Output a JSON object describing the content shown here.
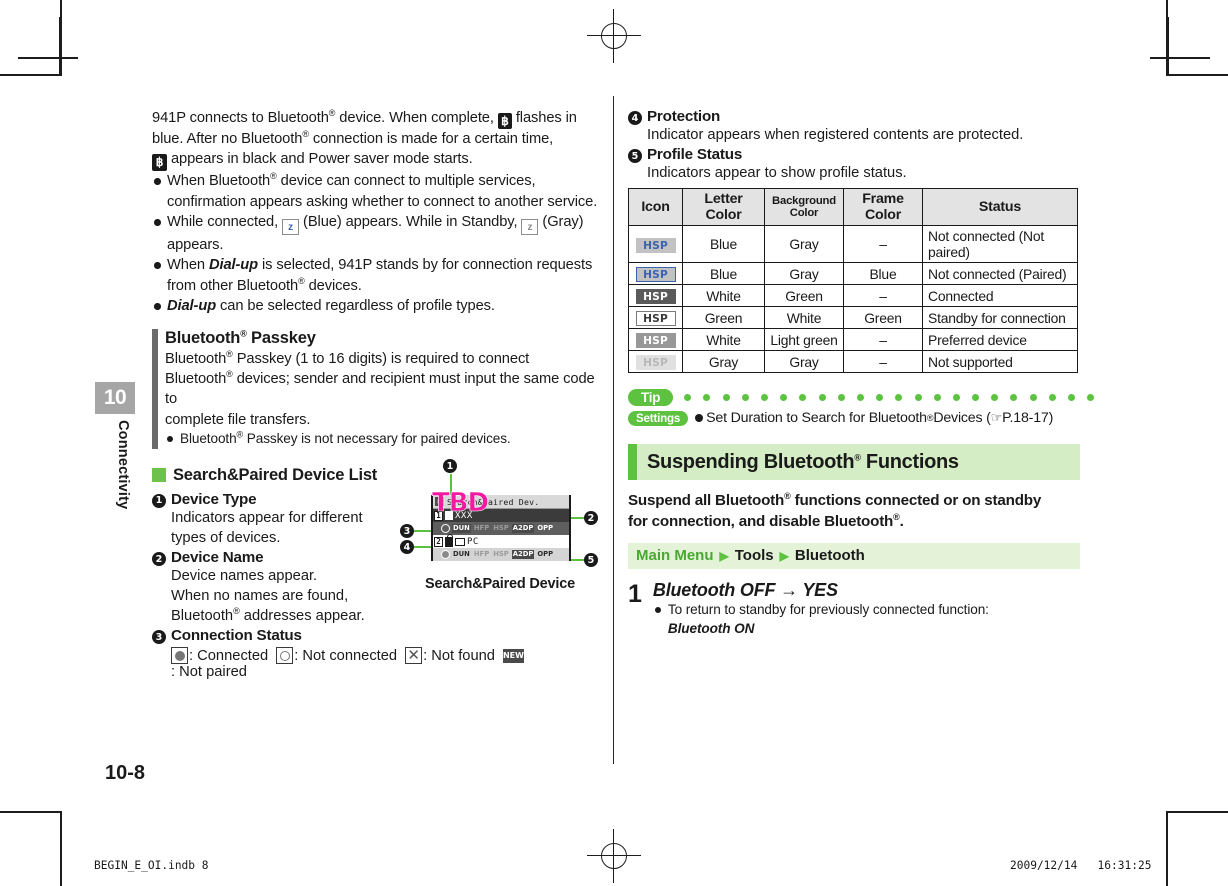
{
  "chapter": {
    "number": "10",
    "name": "Connectivity"
  },
  "page": {
    "number": "10-8"
  },
  "footer": {
    "file": "BEGIN_E_OI.indb     8",
    "stamp": "2009/12/14   16:31:25"
  },
  "left_column": {
    "intro": {
      "line1_a": "941P connects to Bluetooth",
      "line1_b": " device. When complete, ",
      "line1_c": " flashes in",
      "line2_a": "blue. After no Bluetooth",
      "line2_b": " connection is made for a certain time,",
      "line3": " appears in black and Power saver mode starts."
    },
    "intro_bullets": [
      "When Bluetooth® device can connect to multiple services, confirmation appears asking whether to connect to another service.",
      "While connected, (Blue) appears. While in Standby, (Gray) appears.",
      "When Dial-up is selected, 941P stands by for connection requests from other Bluetooth® devices.",
      "Dial-up can be selected regardless of profile types."
    ],
    "passkey": {
      "heading_a": "Bluetooth",
      "heading_b": " Passkey",
      "body_l1_a": "Bluetooth",
      "body_l1_b": " Passkey (1 to 16 digits) is required to connect",
      "body_l2_a": "Bluetooth",
      "body_l2_b": " devices; sender and recipient must input the same code to",
      "body_l3": "complete file transfers.",
      "bullet_a": "Bluetooth",
      "bullet_b": " Passkey is not necessary for paired devices."
    },
    "device_list": {
      "heading": "Search&Paired Device List",
      "items": [
        {
          "n": "1",
          "title": "Device Type",
          "lines": [
            "Indicators appear for different",
            "types of devices."
          ]
        },
        {
          "n": "2",
          "title": "Device Name",
          "lines": [
            "Device names appear.",
            "When no names are found,",
            "Bluetooth® addresses appear."
          ]
        },
        {
          "n": "3",
          "title": "Connection Status",
          "lines": []
        }
      ],
      "status_legend": [
        {
          "icon": "filled-circle-icon",
          "label": ": Connected"
        },
        {
          "icon": "hollow-circle-icon",
          "label": ": Not connected"
        },
        {
          "icon": "cross-icon",
          "label": ": Not found"
        },
        {
          "icon": "new-badge-icon",
          "label": ": Not paired"
        }
      ]
    },
    "mock": {
      "caption": "Search&Paired Device",
      "screen_title": "Search&Paired Dev.",
      "row1_index": "1",
      "row1_name": "XXX",
      "row2_index": "2",
      "row2_name": "PC",
      "row1_profiles": [
        "DUN",
        "HFP",
        "HSP",
        "A2DP",
        "OPP"
      ],
      "row2_profiles": [
        "DUN",
        "HFP",
        "HSP",
        "A2DP",
        "OPP"
      ],
      "overlay": "TBD",
      "callouts": [
        "1",
        "2",
        "3",
        "4",
        "5"
      ]
    }
  },
  "right_column": {
    "items": [
      {
        "n": "4",
        "title": "Protection",
        "body": "Indicator appears when registered contents are protected."
      },
      {
        "n": "5",
        "title": "Profile Status",
        "body": "Indicators appear to show profile status."
      }
    ],
    "profile_table": {
      "headers": [
        "Icon",
        "Letter Color",
        "Background Color",
        "Frame Color",
        "Status"
      ],
      "icon_label": "HSP",
      "rows": [
        {
          "letter": "Blue",
          "background": "Gray",
          "frame": "–",
          "status": "Not connected (Not paired)",
          "swatch": {
            "fg": "#3b63b2",
            "bg": "#c2c2c2",
            "border": "none"
          }
        },
        {
          "letter": "Blue",
          "background": "Gray",
          "frame": "Blue",
          "status": "Not connected (Paired)",
          "swatch": {
            "fg": "#3b63b2",
            "bg": "#c2c2c2",
            "border": "#3b63b2"
          }
        },
        {
          "letter": "White",
          "background": "Green",
          "frame": "–",
          "status": "Connected",
          "swatch": {
            "fg": "#ffffff",
            "bg": "#5a5a5a",
            "border": "none"
          }
        },
        {
          "letter": "Green",
          "background": "White",
          "frame": "Green",
          "status": "Standby for connection",
          "swatch": {
            "fg": "#3a3a3a",
            "bg": "#ffffff",
            "border": "#7a7a7a"
          }
        },
        {
          "letter": "White",
          "background": "Light green",
          "frame": "–",
          "status": "Preferred device",
          "swatch": {
            "fg": "#ffffff",
            "bg": "#989898",
            "border": "none"
          }
        },
        {
          "letter": "Gray",
          "background": "Gray",
          "frame": "–",
          "status": "Not supported",
          "swatch": {
            "fg": "#b8b8b8",
            "bg": "#e0e0e0",
            "border": "none"
          }
        }
      ]
    },
    "tip": {
      "label": "Tip",
      "settings_label": "Settings",
      "text_a": "Set Duration to Search for Bluetooth",
      "text_b": " Devices (",
      "ref": "P.18-17",
      "text_c": ")"
    },
    "section": {
      "heading_a": "Suspending Bluetooth",
      "heading_b": " Functions",
      "lead_l1_a": "Suspend all Bluetooth",
      "lead_l1_b": " functions connected or on standby",
      "lead_l2_a": "for connection, and disable Bluetooth",
      "lead_l2_b": ".",
      "main_menu": {
        "root": "Main Menu",
        "path": [
          "Tools",
          "Bluetooth"
        ]
      },
      "step": {
        "number": "1",
        "title": "Bluetooth OFF → YES",
        "bullet_line1": "To return to standby for previously connected function:",
        "bullet_line2": "Bluetooth ON"
      }
    }
  },
  "colors": {
    "accent_green": "#5cc23f",
    "pale_green": "#d4edc4",
    "menu_green": "#e4f2d8",
    "magenta": "#f01ba0",
    "bar_gray": "#6b6b6b"
  }
}
